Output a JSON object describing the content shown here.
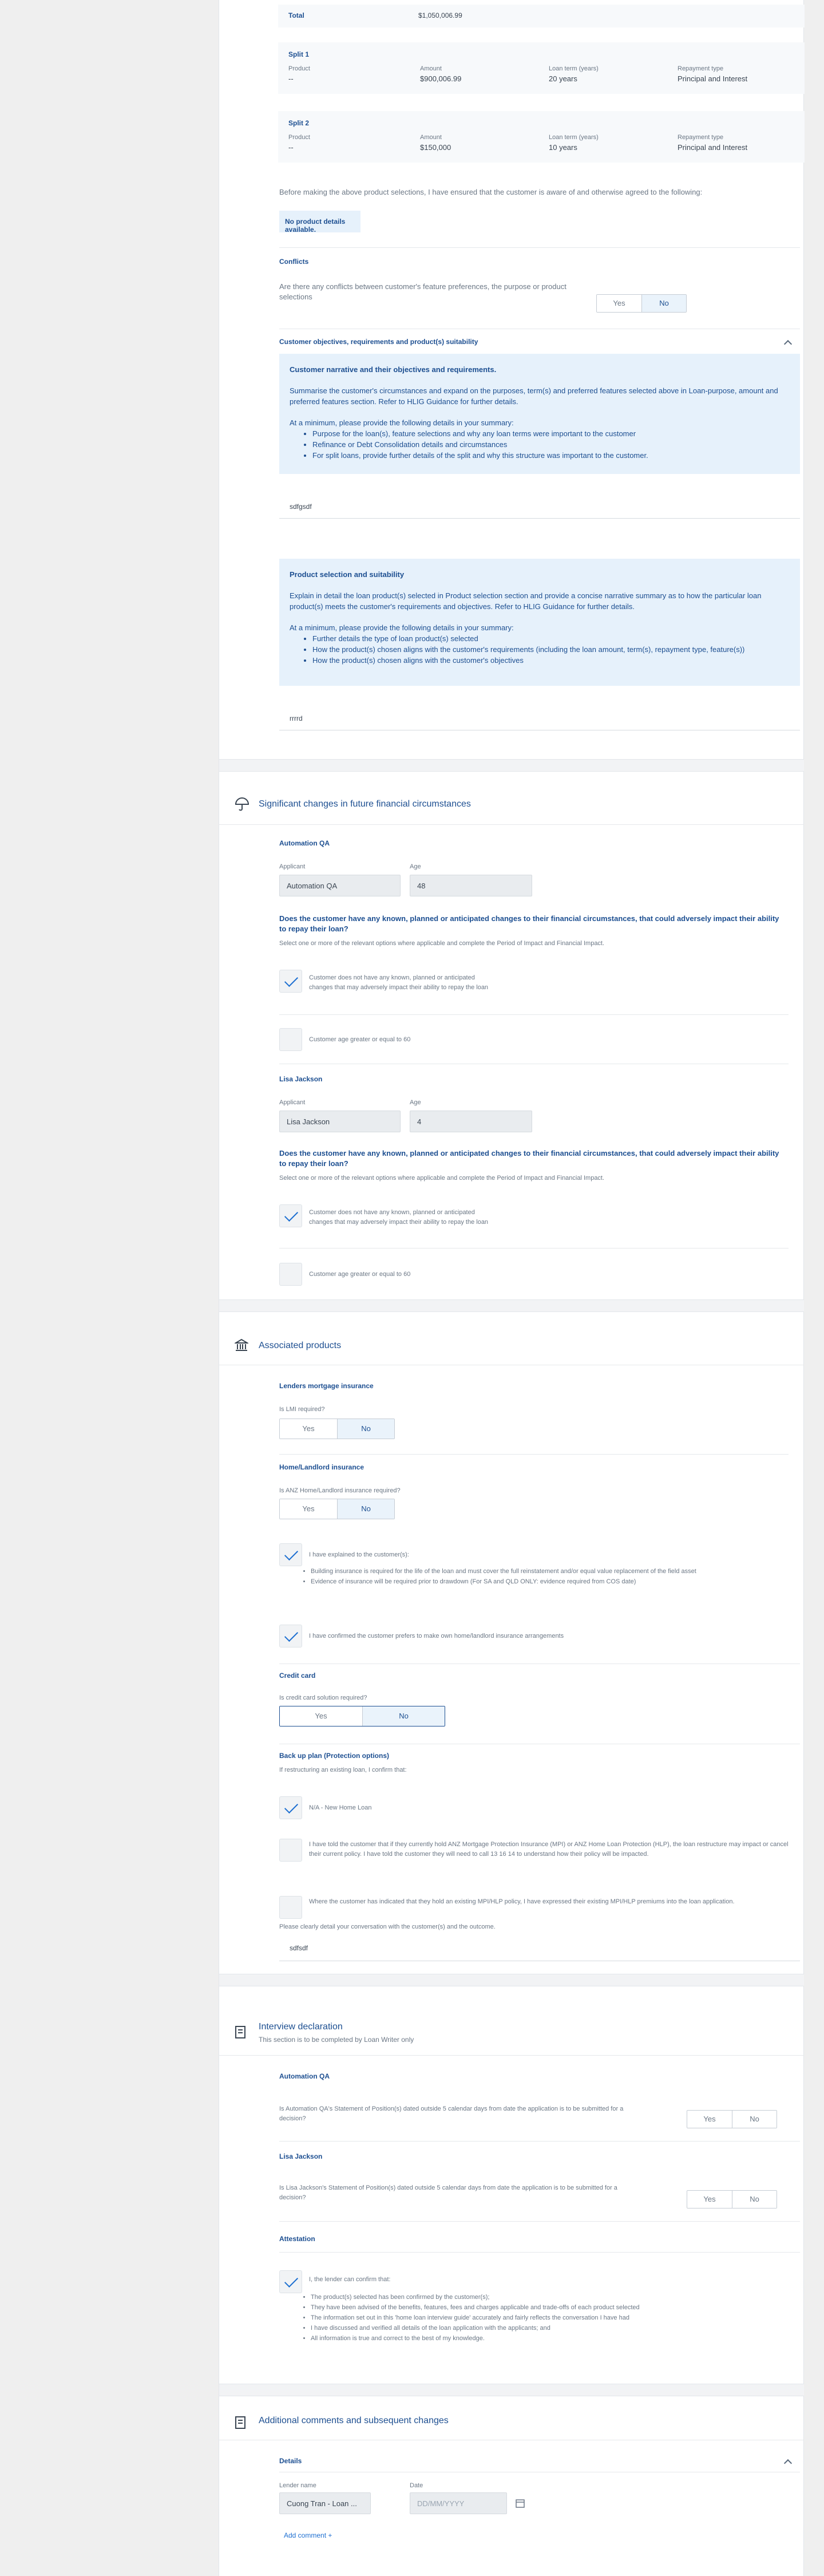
{
  "loan": {
    "total_label": "Total",
    "total_value": "$1,050,006.99",
    "split1": {
      "title": "Split 1",
      "product_label": "Product",
      "product": "--",
      "amount_label": "Amount",
      "amount": "$900,006.99",
      "term_label": "Loan term (years)",
      "term": "20 years",
      "repay_label": "Repayment type",
      "repay": "Principal and Interest"
    },
    "split2": {
      "title": "Split 2",
      "product_label": "Product",
      "product": "--",
      "amount_label": "Amount",
      "amount": "$150,000",
      "term_label": "Loan term (years)",
      "term": "10 years",
      "repay_label": "Repayment type",
      "repay": "Principal and Interest"
    },
    "ensure_text": "Before making the above product selections, I have ensured that the customer is aware of and otherwise agreed to the following:",
    "no_details": "No product details available."
  },
  "conflicts": {
    "title": "Conflicts",
    "question": "Are there any conflicts between customer's feature preferences, the purpose or product selections",
    "yes": "Yes",
    "no": "No"
  },
  "objectives": {
    "title": "Customer objectives, requirements and product(s) suitability",
    "notice_title": "Customer narrative and their objectives and requirements.",
    "notice_body": "Summarise the customer's circumstances and expand on the purposes, term(s) and preferred features selected above in Loan-purpose, amount and preferred features section. Refer to HLIG Guidance for further details.",
    "notice_intro": "At a minimum, please provide the following details in your summary:",
    "bullets": [
      "Purpose for the loan(s), feature selections and why any loan terms were important to the customer",
      "Refinance or Debt Consolidation details and circumstances",
      "For split loans, provide further details of the split and why this structure was important to the customer."
    ],
    "answer": "sdfgsdf"
  },
  "product_selection": {
    "notice_title": "Product selection and suitability",
    "notice_body": "Explain in detail the loan product(s) selected in Product selection section and provide a concise narrative summary as to how the particular loan product(s) meets the customer's requirements and objectives. Refer to HLIG Guidance for further details.",
    "notice_intro": "At a minimum, please provide the following details in your summary:",
    "bullets": [
      "Further details the type of loan product(s) selected",
      "How the product(s) chosen aligns with the customer's requirements (including the loan amount, term(s), repayment type, feature(s))",
      "How the product(s) chosen aligns with the customer's objectives"
    ],
    "answer": "rrrrd"
  },
  "future_changes": {
    "title": "Significant changes in future financial circumstances",
    "applicants": [
      {
        "name": "Automation QA",
        "applicant_label": "Applicant",
        "applicant_value": "Automation QA",
        "age_label": "Age",
        "age_value": "48",
        "question": "Does the customer have any known, planned or anticipated changes to their financial circumstances, that could adversely impact their ability to repay their loan?",
        "hint": "Select one or more of the relevant options where applicable and complete the Period of Impact and Financial Impact.",
        "opt1": "Customer does not have any known, planned or anticipated changes that may adversely impact their ability to repay the loan",
        "opt2": "Customer age greater or equal to 60"
      },
      {
        "name": "Lisa Jackson",
        "applicant_label": "Applicant",
        "applicant_value": "Lisa Jackson",
        "age_label": "Age",
        "age_value": "4",
        "question": "Does the customer have any known, planned or anticipated changes to their financial circumstances, that could adversely impact their ability to repay their loan?",
        "hint": "Select one or more of the relevant options where applicable and complete the Period of Impact and Financial Impact.",
        "opt1": "Customer does not have any known, planned or anticipated changes that may adversely impact their ability to repay the loan",
        "opt2": "Customer age greater or equal to 60"
      }
    ]
  },
  "associated": {
    "title": "Associated products",
    "lmi_title": "Lenders mortgage insurance",
    "lmi_q": "Is LMI required?",
    "home_title": "Home/Landlord insurance",
    "home_q": "Is ANZ Home/Landlord insurance required?",
    "yes": "Yes",
    "no": "No",
    "explained": "I have explained to the customer(s):",
    "explained_bullets": [
      "Building insurance is required for the life of the loan and must cover the full reinstatement and/or equal value replacement of the field asset",
      "Evidence of insurance will be required prior to drawdown (For SA and QLD ONLY: evidence required from COS date)"
    ],
    "confirmed": "I have confirmed the customer prefers to make own home/landlord insurance arrangements",
    "cc_title": "Credit card",
    "cc_q": "Is credit card solution required?",
    "backup_title": "Back up plan (Protection options)",
    "backup_q": "If restructuring an existing loan, I confirm that:",
    "backup_opt1": "N/A - New Home Loan",
    "backup_opt2": "I have told the customer that if they currently hold ANZ Mortgage Protection Insurance (MPI) or ANZ Home Loan Protection (HLP), the loan restructure may impact or cancel their current policy. I have told the customer they will need to call 13 16 14 to understand how their policy will be impacted.",
    "backup_opt3": "Where the customer has indicated that they hold an existing MPI/HLP policy, I have expressed their existing MPI/HLP premiums into the loan application.",
    "conversation_label": "Please clearly detail your conversation with the customer(s) and the outcome.",
    "conversation_value": "sdfsdf"
  },
  "interview": {
    "title": "Interview declaration",
    "subtitle": "This section is to be completed by Loan Writer only",
    "applicants": [
      {
        "name": "Automation QA",
        "question": "Is Automation QA's Statement of Position(s) dated outside 5 calendar days from date the application is to be submitted for a decision?"
      },
      {
        "name": "Lisa Jackson",
        "question": "Is Lisa Jackson's Statement of Position(s) dated outside 5 calendar days from date the application is to be submitted for a decision?"
      }
    ],
    "yes": "Yes",
    "no": "No",
    "attestation_title": "Attestation",
    "attestation_lead": "I, the lender can confirm that:",
    "attestation_bullets": [
      "The product(s) selected has been confirmed by the customer(s);",
      "They have been advised of the benefits, features, fees and charges applicable and trade-offs of each product selected",
      "The information set out in this 'home loan interview guide' accurately and fairly reflects the conversation I have had",
      "I have discussed and verified all details of the loan application with the applicants; and",
      "All information is true and correct to the best of my knowledge."
    ]
  },
  "comments": {
    "title": "Additional comments and subsequent changes",
    "details_title": "Details",
    "lender_label": "Lender name",
    "lender_value": "Cuong Tran - Loan ...",
    "date_label": "Date",
    "date_placeholder": "DD/MM/YYYY",
    "add_comment": "Add comment  +"
  }
}
